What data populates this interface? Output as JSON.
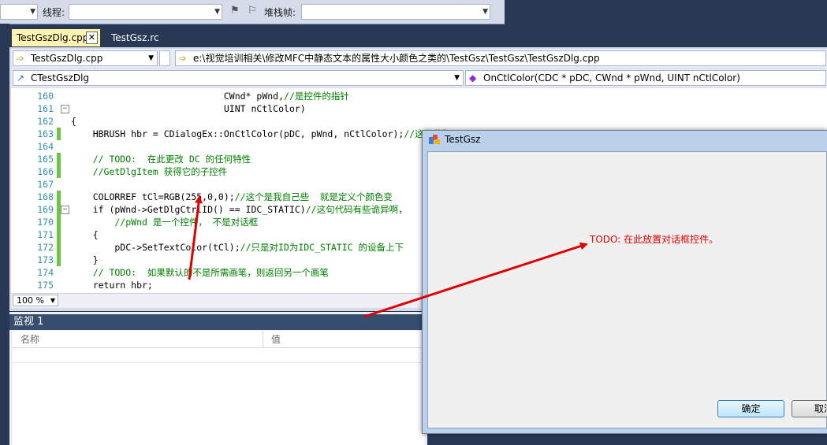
{
  "toolbar": {
    "thread_label": "线程:",
    "stackframe_label": "堆栈帧:"
  },
  "tabs": [
    {
      "label": "TestGszDlg.cpp",
      "active": true
    },
    {
      "label": "TestGsz.rc",
      "active": false
    }
  ],
  "nav": {
    "file_combo": "TestGszDlg.cpp",
    "path": "e:\\视觉培训相关\\修改MFC中静态文本的属性大小颜色之类的\\TestGsz\\TestGsz\\TestGszDlg.cpp",
    "class_combo": "CTestGszDlg",
    "member_combo": "OnCtlColor(CDC * pDC, CWnd * pWnd, UINT nCtlColor)"
  },
  "code_lines": [
    {
      "num": "160",
      "text": "                            CWnd* pWnd,//是控件的指针"
    },
    {
      "num": "161",
      "text": "                            UINT nCtlColor)"
    },
    {
      "num": "162",
      "text": "{"
    },
    {
      "num": "163",
      "text": "    HBRUSH hbr = CDialogEx::OnCtlColor(pDC, pWnd, nCtlColor);//这是获取"
    },
    {
      "num": "164",
      "text": ""
    },
    {
      "num": "165",
      "text": "    // TODO:  在此更改 DC 的任何特性"
    },
    {
      "num": "166",
      "text": "    //GetDlgItem 获得它的子控件"
    },
    {
      "num": "167",
      "text": ""
    },
    {
      "num": "168",
      "text": "    COLORREF tCl=RGB(255,0,0);//这个是我自己些  就是定义个颜色变"
    },
    {
      "num": "169",
      "text": "    if (pWnd->GetDlgCtrlID() == IDC_STATIC)//这句代码有些诡异啊，"
    },
    {
      "num": "170",
      "text": "        //pWnd 是一个控件， 不是对话框"
    },
    {
      "num": "171",
      "text": "    {"
    },
    {
      "num": "172",
      "text": "        pDC->SetTextColor(tCl);//只是对ID为IDC_STATIC 的设备上下"
    },
    {
      "num": "173",
      "text": "    }"
    },
    {
      "num": "174",
      "text": "    // TODO:  如果默认的不是所需画笔，则返回另一个画笔"
    },
    {
      "num": "175",
      "text": "    return hbr;"
    }
  ],
  "zoom": "100 %",
  "watch": {
    "title": "监视 1",
    "col_name": "名称",
    "col_value": "值"
  },
  "dialog": {
    "title": "TestGsz",
    "static_text": "TODO: 在此放置对话框控件。",
    "ok_label": "确定",
    "cancel_label": "取消"
  },
  "colors": {
    "arrow": "#e00000",
    "static_text": "#e00000",
    "active_tab": "#fff4b0"
  }
}
